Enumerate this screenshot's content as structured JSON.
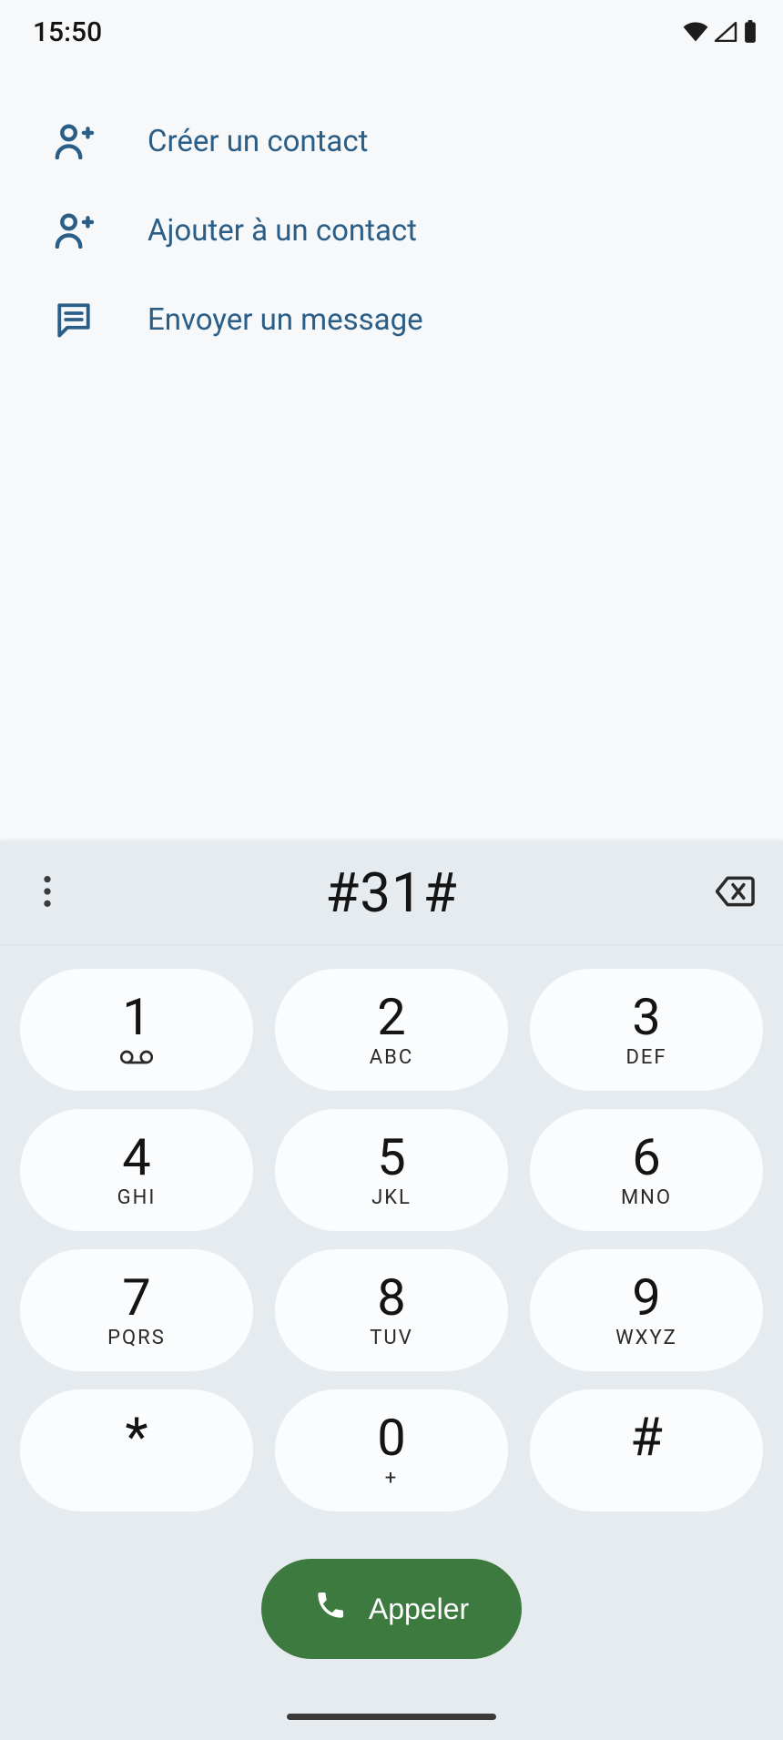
{
  "status": {
    "time": "15:50"
  },
  "actions": {
    "create": "Créer un contact",
    "add": "Ajouter à un contact",
    "message": "Envoyer un message"
  },
  "dialer": {
    "entered": "#31#",
    "call_label": "Appeler",
    "keys": {
      "k1": {
        "digit": "1",
        "sub": ""
      },
      "k2": {
        "digit": "2",
        "sub": "ABC"
      },
      "k3": {
        "digit": "3",
        "sub": "DEF"
      },
      "k4": {
        "digit": "4",
        "sub": "GHI"
      },
      "k5": {
        "digit": "5",
        "sub": "JKL"
      },
      "k6": {
        "digit": "6",
        "sub": "MNO"
      },
      "k7": {
        "digit": "7",
        "sub": "PQRS"
      },
      "k8": {
        "digit": "8",
        "sub": "TUV"
      },
      "k9": {
        "digit": "9",
        "sub": "WXYZ"
      },
      "kstar": {
        "digit": "*",
        "sub": ""
      },
      "k0": {
        "digit": "0",
        "sub": "+"
      },
      "khash": {
        "digit": "#",
        "sub": ""
      }
    }
  }
}
